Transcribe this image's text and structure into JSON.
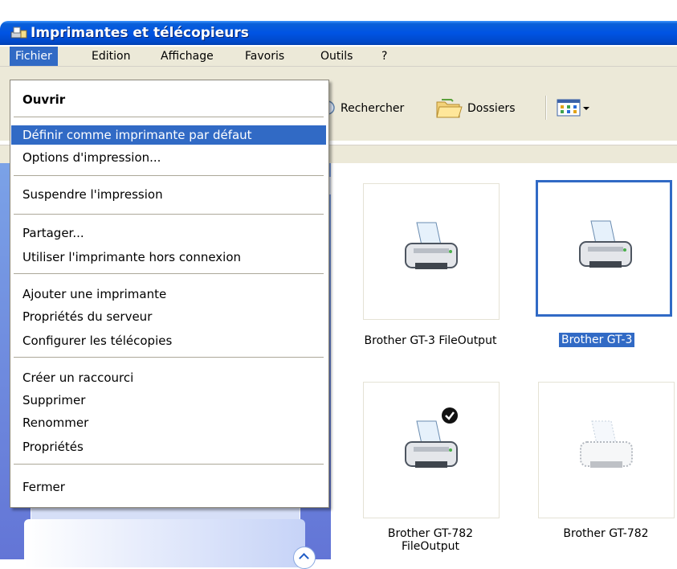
{
  "window": {
    "title": "Imprimantes et télécopieurs"
  },
  "menubar": {
    "items": [
      {
        "label": "Fichier"
      },
      {
        "label": "Edition"
      },
      {
        "label": "Affichage"
      },
      {
        "label": "Favoris"
      },
      {
        "label": "Outils"
      },
      {
        "label": "?"
      }
    ]
  },
  "toolbar": {
    "search_label": "Rechercher",
    "folders_label": "Dossiers",
    "views_icon": "views-icon"
  },
  "file_menu": {
    "items": [
      {
        "label": "Ouvrir",
        "bold": true
      },
      {
        "label": "Définir comme imprimante par défaut",
        "highlighted": true
      },
      {
        "label": "Options d'impression..."
      },
      {
        "label": "Suspendre l'impression"
      },
      {
        "label": "Partager..."
      },
      {
        "label": "Utiliser l'imprimante hors connexion"
      },
      {
        "label": "Ajouter une imprimante"
      },
      {
        "label": "Propriétés du serveur"
      },
      {
        "label": "Configurer les télécopies"
      },
      {
        "label": "Créer un raccourci"
      },
      {
        "label": "Supprimer"
      },
      {
        "label": "Renommer"
      },
      {
        "label": "Propriétés"
      },
      {
        "label": "Fermer"
      }
    ]
  },
  "printers": [
    {
      "name": "Brother GT-3 FileOutput",
      "state": "normal"
    },
    {
      "name": "Brother GT-3",
      "state": "selected"
    },
    {
      "name_line1": "Brother GT-782",
      "name_line2": "FileOutput",
      "state": "default"
    },
    {
      "name": "Brother GT-782",
      "state": "offline"
    }
  ]
}
